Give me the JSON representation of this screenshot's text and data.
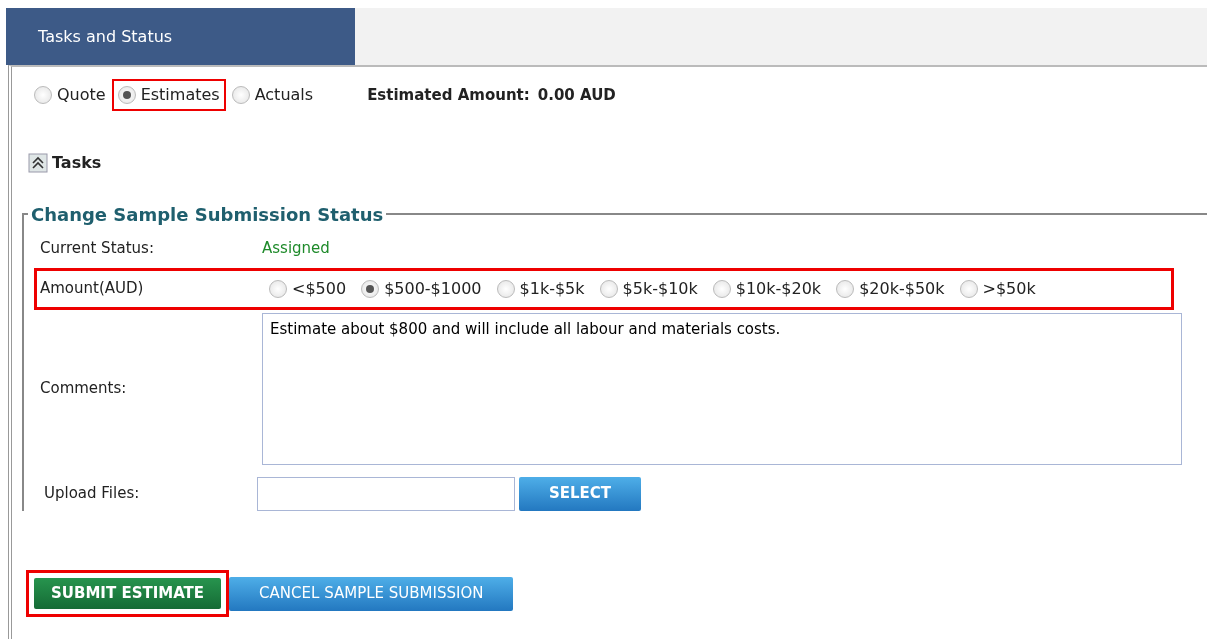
{
  "tab": {
    "label": "Tasks and Status",
    "selected": true
  },
  "record_types": [
    {
      "label": "Quote",
      "selected": false,
      "highlighted": false
    },
    {
      "label": "Estimates",
      "selected": true,
      "highlighted": true
    },
    {
      "label": "Actuals",
      "selected": false,
      "highlighted": false
    }
  ],
  "estimated_amount": {
    "label": "Estimated Amount:",
    "value": "0.00 AUD"
  },
  "tasks_section": {
    "label": "Tasks",
    "expanded": true
  },
  "status_form": {
    "legend": "Change Sample Submission Status",
    "current_status": {
      "label": "Current Status:",
      "value": "Assigned"
    },
    "amount": {
      "label": "Amount(AUD)",
      "highlighted": true,
      "options": [
        {
          "label": "<$500",
          "selected": false
        },
        {
          "label": "$500-$1000",
          "selected": true
        },
        {
          "label": "$1k-$5k",
          "selected": false
        },
        {
          "label": "$5k-$10k",
          "selected": false
        },
        {
          "label": "$10k-$20k",
          "selected": false
        },
        {
          "label": "$20k-$50k",
          "selected": false
        },
        {
          "label": ">$50k",
          "selected": false
        }
      ]
    },
    "comments": {
      "label": "Comments:",
      "value": "Estimate about $800 and will include all labour and materials costs."
    },
    "upload": {
      "label": "Upload Files:",
      "button": "SELECT"
    }
  },
  "actions": [
    {
      "kind": "submit",
      "label": "SUBMIT ESTIMATE",
      "highlighted": true
    },
    {
      "kind": "cancel",
      "label": "CANCEL SAMPLE SUBMISSION",
      "highlighted": false
    }
  ]
}
